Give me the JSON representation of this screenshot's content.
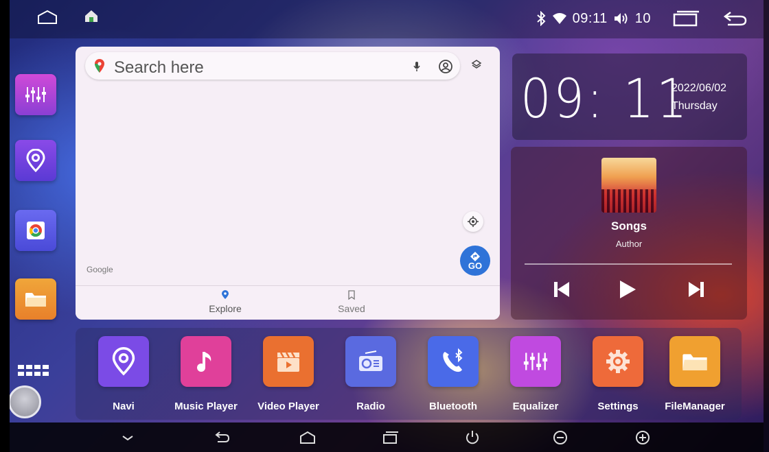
{
  "status_bar": {
    "time": "09:11",
    "volume": "10",
    "icons": [
      "home-outline-icon",
      "app-house-icon",
      "bluetooth-icon",
      "wifi-icon",
      "speaker-icon",
      "recent-apps-icon",
      "back-icon"
    ]
  },
  "left_dock": {
    "items": [
      {
        "name": "equalizer",
        "icon": "equalizer-icon",
        "color": "#c84ad8"
      },
      {
        "name": "navi",
        "icon": "location-pin-icon",
        "color": "#7a46e4"
      },
      {
        "name": "chrome",
        "icon": "chrome-icon",
        "color": "#5c5ce8"
      },
      {
        "name": "files",
        "icon": "folder-icon",
        "color": "#f0962f"
      }
    ],
    "app_drawer_icon": "grid-icon"
  },
  "map": {
    "search_placeholder": "Search here",
    "go_label": "GO",
    "logo": "Google",
    "tabs": [
      {
        "label": "Explore",
        "icon": "location-pin-icon",
        "active": true
      },
      {
        "label": "Saved",
        "icon": "bookmark-icon",
        "active": false
      }
    ]
  },
  "clock": {
    "time": "09:11",
    "date": "2022/06/02",
    "day": "Thursday"
  },
  "music": {
    "title": "Songs",
    "author": "Author",
    "progress": 0.0
  },
  "apps": [
    {
      "label": "Navi",
      "icon": "location-pin-icon",
      "color": "#7b4be6"
    },
    {
      "label": "Music Player",
      "icon": "music-note-icon",
      "color": "#e0409a"
    },
    {
      "label": "Video Player",
      "icon": "clapperboard-icon",
      "color": "#ea7030"
    },
    {
      "label": "Radio",
      "icon": "radio-icon",
      "color": "#5a6ae0"
    },
    {
      "label": "Bluetooth",
      "icon": "bluetooth-phone-icon",
      "color": "#4a6ae8"
    },
    {
      "label": "Equalizer",
      "icon": "equalizer-icon",
      "color": "#c04ae0"
    },
    {
      "label": "Settings",
      "icon": "gear-icon",
      "color": "#ee6a3a"
    },
    {
      "label": "FileManager",
      "icon": "folder-icon",
      "color": "#f0a030"
    }
  ],
  "nav_bar": {
    "buttons": [
      "hide-icon",
      "back-icon",
      "home-icon",
      "recent-apps-icon",
      "power-icon",
      "volume-down-icon",
      "volume-up-icon"
    ]
  }
}
